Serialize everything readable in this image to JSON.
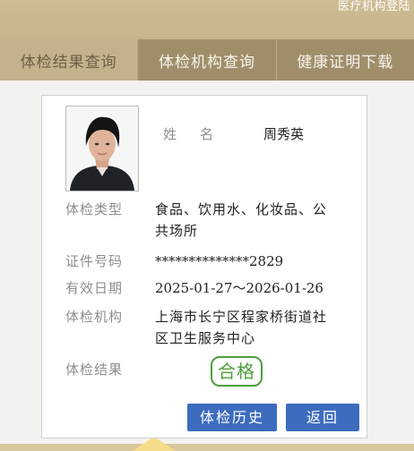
{
  "header": {
    "institution_login": "医疗机构登陆"
  },
  "tabs": [
    {
      "label": "体检结果查询",
      "active": true
    },
    {
      "label": "体检机构查询",
      "active": false
    },
    {
      "label": "健康证明下载",
      "active": false
    }
  ],
  "record": {
    "name_label_1": "姓",
    "name_label_2": "名",
    "name": "周秀英",
    "type_label": "体检类型",
    "type": "食品、饮用水、化妆品、公共场所",
    "cert_label": "证件号码",
    "cert_no": "**************2829",
    "valid_label": "有效日期",
    "valid": "2025-01-27～2026-01-26",
    "org_label": "体检机构",
    "org": "上海市长宁区程家桥街道社区卫生服务中心",
    "result_label": "体检结果",
    "result": "合格"
  },
  "buttons": {
    "history": "体检历史",
    "back": "返回"
  },
  "colors": {
    "tab_bar": "#a08e6b",
    "active_tab": "#c4b28c",
    "button": "#3d6cbf",
    "stamp": "#4f9f3c"
  }
}
